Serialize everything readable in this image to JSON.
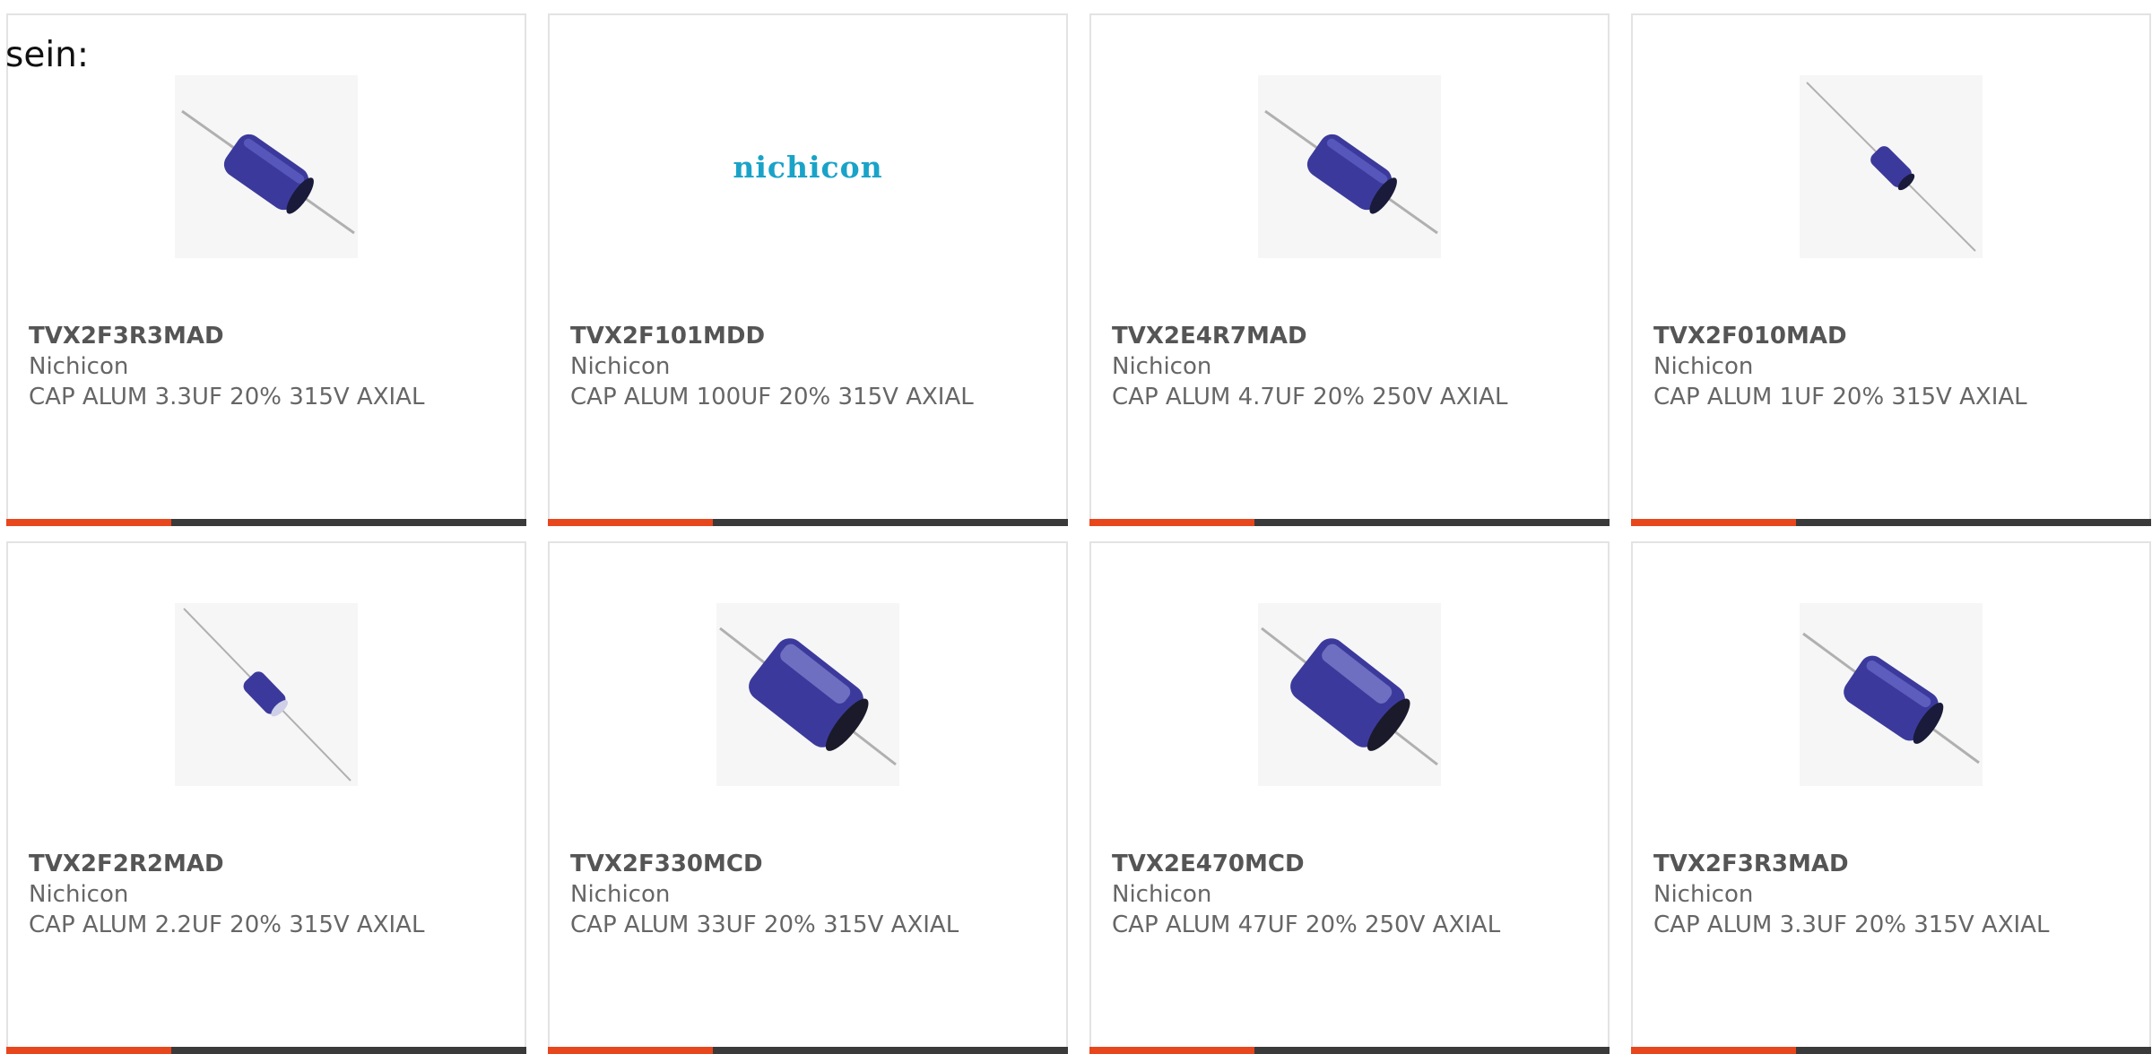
{
  "intro_text": "sein:",
  "colors": {
    "card_border": "#e3e3e3",
    "bar_dark": "#3a3a3a",
    "bar_accent": "#e8461d",
    "capacitor_blue": "#3b3a9c",
    "logo_text": "#1aa3c8"
  },
  "products": [
    {
      "part_no": "TVX2F3R3MAD",
      "manufacturer": "Nichicon",
      "description": "CAP ALUM 3.3UF 20% 315V AXIAL",
      "image": "capacitor-photo"
    },
    {
      "part_no": "TVX2F101MDD",
      "manufacturer": "Nichicon",
      "description": "CAP ALUM 100UF 20% 315V AXIAL",
      "image": "nichicon-logo",
      "logo_text": "nichicon"
    },
    {
      "part_no": "TVX2E4R7MAD",
      "manufacturer": "Nichicon",
      "description": "CAP ALUM 4.7UF 20% 250V AXIAL",
      "image": "capacitor-photo"
    },
    {
      "part_no": "TVX2F010MAD",
      "manufacturer": "Nichicon",
      "description": "CAP ALUM 1UF 20% 315V AXIAL",
      "image": "capacitor-photo"
    },
    {
      "part_no": "TVX2F2R2MAD",
      "manufacturer": "Nichicon",
      "description": "CAP ALUM 2.2UF 20% 315V AXIAL",
      "image": "capacitor-photo"
    },
    {
      "part_no": "TVX2F330MCD",
      "manufacturer": "Nichicon",
      "description": "CAP ALUM 33UF 20% 315V AXIAL",
      "image": "capacitor-photo"
    },
    {
      "part_no": "TVX2E470MCD",
      "manufacturer": "Nichicon",
      "description": "CAP ALUM 47UF 20% 250V AXIAL",
      "image": "capacitor-photo"
    },
    {
      "part_no": "TVX2F3R3MAD",
      "manufacturer": "Nichicon",
      "description": "CAP ALUM 3.3UF 20% 315V AXIAL",
      "image": "capacitor-photo"
    }
  ]
}
